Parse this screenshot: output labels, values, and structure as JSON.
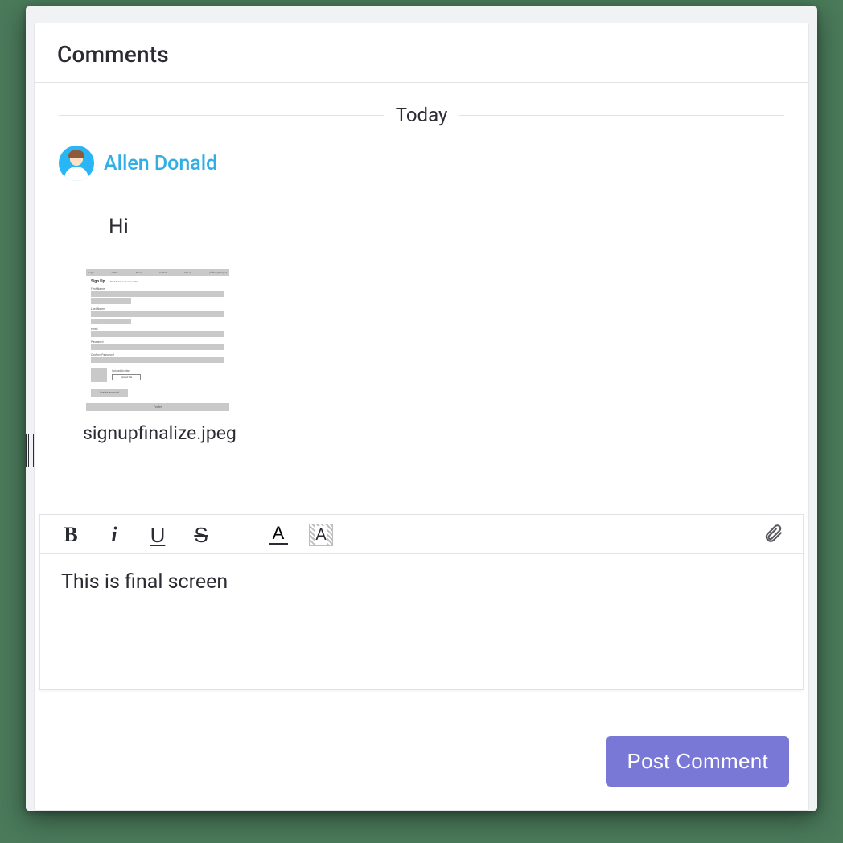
{
  "panel": {
    "title": "Comments"
  },
  "divider": {
    "label": "Today"
  },
  "comment": {
    "author": "Allen Donald",
    "text": "Hi",
    "attachmentName": "signupfinalize.jpeg"
  },
  "thumb": {
    "nav": [
      "Login",
      "Gallery",
      "About",
      "Contact",
      "Sign up",
      "profile/login/logout"
    ],
    "heading": "Sign Up",
    "subheading": "Already have an account?",
    "fields": [
      "First Name",
      "Last Name",
      "email",
      "Password",
      "Confirm Password"
    ],
    "uploadLabel": "Upload Avatar",
    "uploadButton": "Upload file",
    "createButton": "Create account",
    "footer": "Footer"
  },
  "editor": {
    "value": "This is final screen",
    "buttons": {
      "bold": "B",
      "italic": "i",
      "underline": "U",
      "strike": "S",
      "textcolor": "A",
      "bgcolor": "A"
    }
  },
  "actions": {
    "post": "Post Comment"
  }
}
